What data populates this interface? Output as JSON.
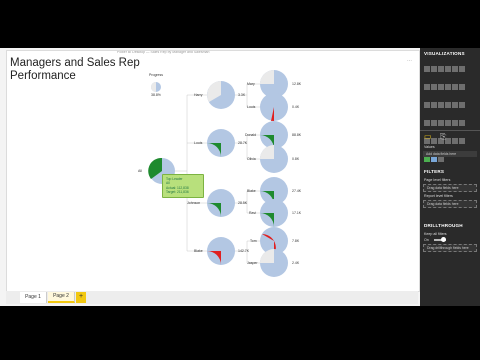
{
  "report": {
    "title": "Managers and Sales Rep Performance",
    "header_path": "Power BI Desktop — Sales Rep by Manager and Salesman"
  },
  "legend_node": {
    "label": "Progress",
    "value": "38.8%"
  },
  "root": {
    "label": "All"
  },
  "tooltip": {
    "line1": "Top Leader",
    "line2": "All",
    "line3": "Actual: 112,838",
    "line4": "Target: 211,836"
  },
  "managers": [
    {
      "label": "Harry",
      "value": "3.3K"
    },
    {
      "label": "Louis",
      "value": "28.7K"
    },
    {
      "label": "Johnson",
      "value": "28.5K"
    },
    {
      "label": "Blake",
      "value": "142.7K"
    }
  ],
  "reps": [
    {
      "label": "Mary",
      "value": "12.8K"
    },
    {
      "label": "Louis",
      "value": "0.4K"
    },
    {
      "label": "Donald",
      "value": "88.8K"
    },
    {
      "label": "Olivia",
      "value": "0.8K"
    },
    {
      "label": "Blake",
      "value": "27.4K"
    },
    {
      "label": "Ravi",
      "value": "17.1K"
    },
    {
      "label": "Tom",
      "value": "7.8K"
    },
    {
      "label": "Jasper",
      "value": "2.4K"
    }
  ],
  "pages": {
    "tab1": "Page 1",
    "tab2": "Page 2",
    "add": "+"
  },
  "panel": {
    "visualizations": "VISUALIZATIONS",
    "values_header": "Values",
    "values_placeholder": "Add data fields here",
    "filters": "FILTERS",
    "page_filters": "Page level filters",
    "page_placeholder": "Drag data fields here",
    "report_filters": "Report level filters",
    "report_placeholder": "Drag data fields here",
    "drill": "DRILLTHROUGH",
    "keep_filters": "Keep all filters",
    "toggle_state": "On",
    "drill_placeholder": "Drag drillthrough fields here"
  },
  "colors": {
    "green": "#1e8a2e",
    "red": "#e02020",
    "blue": "#b3c7e3",
    "tooltip": "#b8e07c"
  }
}
